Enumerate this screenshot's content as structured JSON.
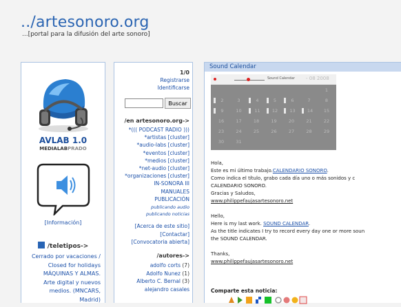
{
  "header": {
    "title": "../artesonoro.org",
    "subtitle": "...[portal para la difusión del arte sonoro]"
  },
  "left": {
    "avlab_title": "AVLAB 1.0",
    "avlab_sub_bold": "MEDIALAB",
    "avlab_sub_light": "PRADO",
    "info_link": "[Información]",
    "teletipos_title": "/teletipos->",
    "teletipos_items": [
      "Cerrado por vacaciones /",
      "Closed for holidays",
      "MÁQUINAS Y ALMAS.",
      "Arte digital y nuevos",
      "medios. (MNCARS,",
      "Madrid)"
    ]
  },
  "middle": {
    "page_indicator": "1/0",
    "register": "Registrarse",
    "login": "Identificarse",
    "search_button": "Buscar",
    "search_value": "",
    "section_title": "/en artesonoro.org->",
    "section_items": [
      "*((( PODCAST RADIO )))",
      "*artistas [cluster]",
      "*audio-labs [cluster]",
      "*eventos [cluster]",
      "*medios [cluster]",
      "*net-audio [cluster]",
      "*organizaciones [cluster]",
      "IN-SONORA III",
      "MANUALES",
      "PUBLICACIÓN"
    ],
    "pub_audio": "publicando audio",
    "pub_noticias": "publicando noticias",
    "about": "[Acerca de este sitio]",
    "contact": "[Contactar]",
    "call": "[Convocatoria abierta]",
    "authors_title": "/autores->",
    "authors": [
      {
        "name": "adolfo corts",
        "count": "(7)"
      },
      {
        "name": "Adolfo Nunez",
        "count": "(1)"
      },
      {
        "name": "Alberto C. Bernal",
        "count": "(3)"
      },
      {
        "name": "alejandro casales",
        "count": ""
      }
    ]
  },
  "right": {
    "title": "Sound Calendar",
    "calendar": {
      "label": "Sound Calendar",
      "month": "- 08  2008",
      "rows": [
        [
          "",
          "",
          "",
          "",
          "",
          "",
          "1"
        ],
        [
          "2",
          "3",
          "4",
          "5",
          "6",
          "7",
          "8"
        ],
        [
          "9",
          "10",
          "11",
          "12",
          "13",
          "14",
          "15"
        ],
        [
          "16",
          "17",
          "18",
          "19",
          "20",
          "21",
          "22"
        ],
        [
          "23",
          "24",
          "25",
          "26",
          "27",
          "28",
          "29"
        ],
        [
          "30",
          "31",
          "",
          "",
          "",
          "",
          ""
        ]
      ]
    },
    "es_greeting": "Hola,",
    "es_line1_pre": "Este es mi último trabajo.",
    "es_line1_link": "CALENDARIO SONORO",
    "es_line1_post": ".",
    "es_line2": "Como indica el título, grabo cada día uno o más sonidos y c",
    "es_line3": "CALENDARIO SONORO.",
    "es_line4": "Gracias y Saludos,",
    "es_url": "www.philippefaujasartesonoro.net",
    "en_greeting": "Hello,",
    "en_line1_pre": "Here is my last work. ",
    "en_line1_link": "SOUND CALENDAR",
    "en_line1_post": ".",
    "en_line2": "As the title indicates I try to record every day one or more soun",
    "en_line3": "the SOUND CALENDAR.",
    "en_thanks": "Thanks,",
    "en_url": "www.philippefaujasartesonoro.net",
    "share_label": "Comparte esta noticia:"
  }
}
